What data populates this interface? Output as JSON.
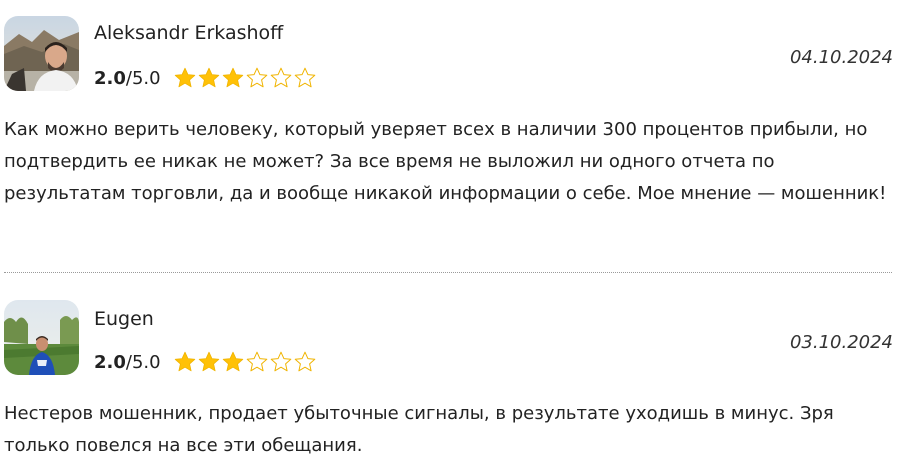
{
  "reviews": [
    {
      "author": "Aleksandr Erkashoff",
      "score": "2.0",
      "separator": "/",
      "max": "5.0",
      "stars_filled": 3,
      "stars_total": 6,
      "date": "04.10.2024",
      "text": "Как можно верить человеку, который уверяет всех в наличии 300 процентов прибыли, но подтвердить ее никак не может? За все время не выложил ни одного отчета по результатам торговли, да и вообще никакой информации о себе. Мое мнение — мошенник!"
    },
    {
      "author": "Eugen",
      "score": "2.0",
      "separator": "/",
      "max": "5.0",
      "stars_filled": 3,
      "stars_total": 6,
      "date": "03.10.2024",
      "text": "Нестеров мошенник, продает убыточные сигналы, в результате уходишь в минус. Зря только повелся на все эти обещания."
    }
  ],
  "colors": {
    "star_fill": "#FFC107",
    "star_outline": "#F0B400",
    "divider": "#9a9a9a"
  }
}
